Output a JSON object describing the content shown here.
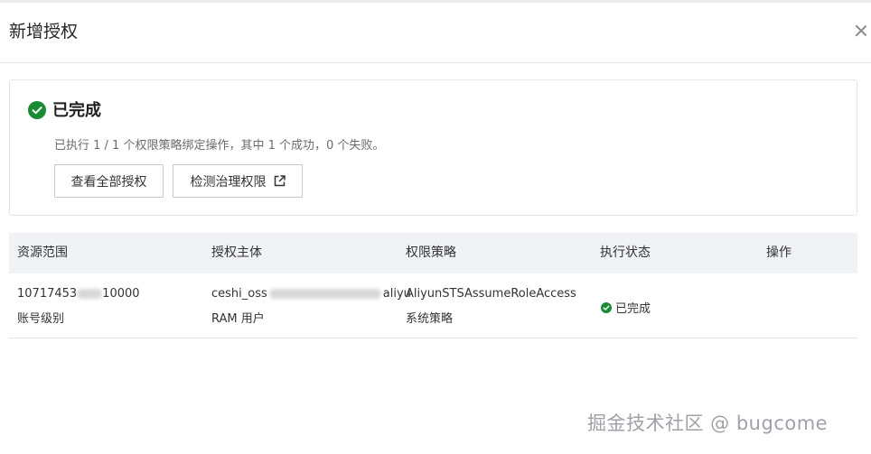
{
  "dialog": {
    "title": "新增授权",
    "close_icon": "close-icon"
  },
  "result": {
    "status_icon": "check-circle-icon",
    "status_color": "#1a8a35",
    "status_title": "已完成",
    "summary": "已执行 1 / 1 个权限策略绑定操作，其中 1 个成功，0 个失败。",
    "buttons": {
      "view_all": "查看全部授权",
      "check_governance": "检测治理权限",
      "external_icon": "external-link-icon"
    }
  },
  "table": {
    "header_bg": "#f0f2f6",
    "columns": [
      "资源范围",
      "授权主体",
      "权限策略",
      "执行状态",
      "操作"
    ],
    "rows": [
      {
        "resource_id": "10717453",
        "resource_id_tail": "10000",
        "resource_level": "账号级别",
        "principal_prefix": "ceshi_oss",
        "principal_suffix": "aliyu",
        "principal_type": "RAM 用户",
        "policy_name": "AliyunSTSAssumeRoleAccess",
        "policy_type": "系统策略",
        "state": "已完成",
        "action": ""
      }
    ]
  },
  "watermark": "掘金技术社区 @ bugcome"
}
